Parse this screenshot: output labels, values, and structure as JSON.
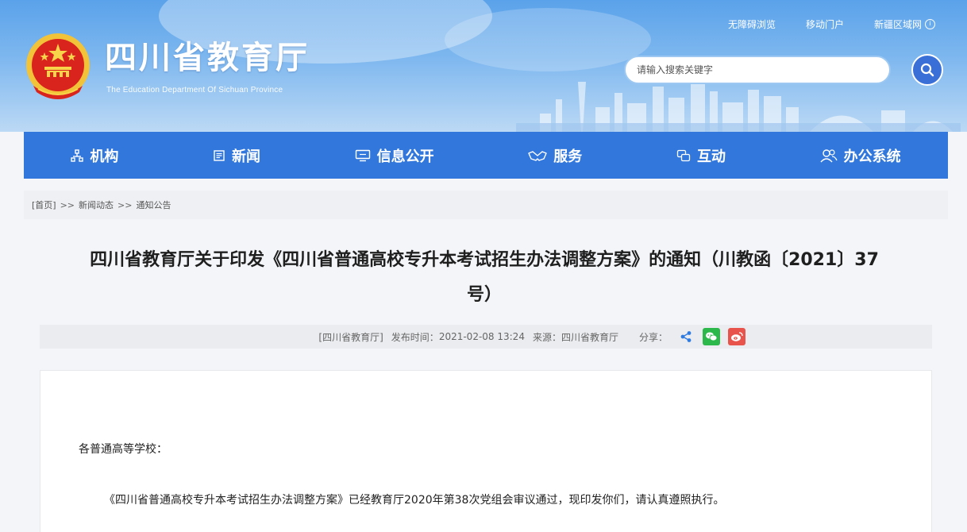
{
  "header": {
    "site_title": "四川省教育厅",
    "site_subtitle": "The Education Department Of Sichuan Province",
    "top_links": [
      {
        "label": "无障碍浏览",
        "icon": ""
      },
      {
        "label": "移动门户",
        "icon": ""
      },
      {
        "label": "新疆区域网",
        "icon": "info-circle-icon"
      }
    ],
    "search": {
      "placeholder": "请输入搜索关键字",
      "button_icon": "search-icon"
    }
  },
  "nav": {
    "items": [
      {
        "label": "机构",
        "icon": "org-icon"
      },
      {
        "label": "新闻",
        "icon": "news-icon"
      },
      {
        "label": "信息公开",
        "icon": "monitor-icon"
      },
      {
        "label": "服务",
        "icon": "handshake-icon"
      },
      {
        "label": "互动",
        "icon": "chat-icon"
      },
      {
        "label": "办公系统",
        "icon": "users-icon"
      }
    ]
  },
  "breadcrumb": {
    "items": [
      "[首页]",
      "新闻动态",
      "通知公告"
    ],
    "separator": ">>"
  },
  "article": {
    "title_line1": "四川省教育厅关于印发《四川省普通高校专升本考试招生办法调整方案》的通知（川教函〔2021〕37",
    "title_line2": "号）",
    "meta": {
      "source_tag": "[四川省教育厅]",
      "publish_label": "发布时间：",
      "publish_time": "2021-02-08 13:24",
      "origin_label": "来源：",
      "origin": "四川省教育厅",
      "share_label": "分享："
    },
    "salutation": "各普通高等学校：",
    "paragraph1": "《四川省普通高校专升本考试招生办法调整方案》已经教育厅2020年第38次党组会审议通过，现印发你们，请认真遵照执行。"
  },
  "colors": {
    "nav_bg": "#3278dc",
    "header_top": "#5aa2ea",
    "share_wechat": "#2cb84a",
    "share_weibo": "#e8544b",
    "share_generic": "#2f7be0"
  }
}
